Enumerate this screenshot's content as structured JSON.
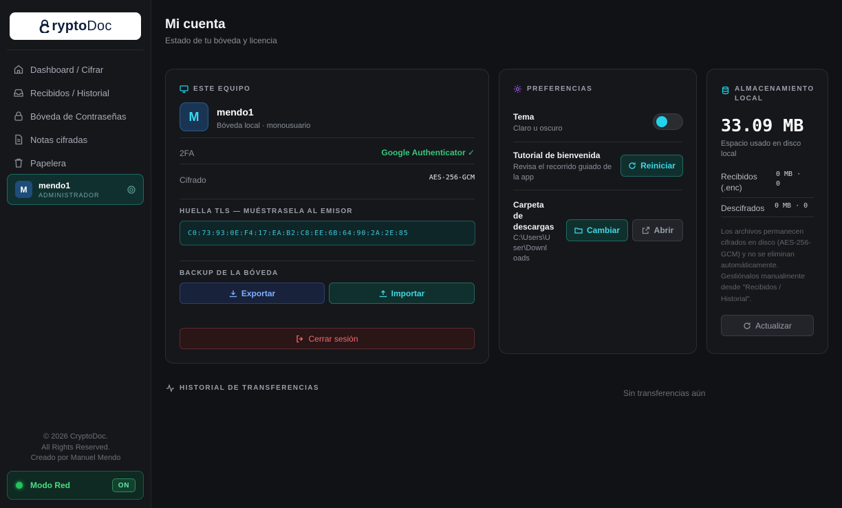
{
  "sidebar": {
    "logo": {
      "mark": "C",
      "rest_bold": "rypto",
      "rest_reg": "Doc"
    },
    "nav": [
      {
        "label": "Dashboard / Cifrar",
        "icon": "home-icon"
      },
      {
        "label": "Recibidos / Historial",
        "icon": "inbox-icon"
      },
      {
        "label": "Bóveda de Contraseñas",
        "icon": "lock-icon"
      },
      {
        "label": "Notas cifradas",
        "icon": "document-icon"
      },
      {
        "label": "Papelera",
        "icon": "trash-icon"
      }
    ],
    "user": {
      "initial": "M",
      "name": "mendo1",
      "role": "ADMINISTRADOR"
    },
    "footer": {
      "line1": "© 2026 CryptoDoc.",
      "line2": "All Rights Reserved.",
      "line3": "Creado por Manuel Mendo"
    },
    "network": {
      "label": "Modo Red",
      "badge": "ON"
    }
  },
  "header": {
    "title": "Mi cuenta",
    "subtitle": "Estado de tu bóveda y licencia"
  },
  "equipo": {
    "heading": "ESTE EQUIPO",
    "initial": "M",
    "name": "mendo1",
    "desc": "Bóveda local · monousuario",
    "twofa_label": "2FA",
    "twofa_value": "Google Authenticator ✓",
    "cipher_label": "Cifrado",
    "cipher_value": "AES-256-GCM",
    "tls_heading": "HUELLA TLS — MUÉSTRASELA AL EMISOR",
    "tls_value": "C0:73:93:0E:F4:17:EA:B2:C8:EE:6B:64:90:2A:2E:85",
    "backup_heading": "BACKUP DE LA BÓVEDA",
    "export_label": "Exportar",
    "import_label": "Importar",
    "logout_label": "Cerrar sesión"
  },
  "preferencias": {
    "heading": "PREFERENCIAS",
    "theme_title": "Tema",
    "theme_sub": "Claro u oscuro",
    "theme_on": true,
    "tutorial_title": "Tutorial de bienvenida",
    "tutorial_sub1": "Revisa el recorrido guiado de",
    "tutorial_sub2": "la app",
    "restart_label": "Reiniciar",
    "folder_title1": "Carpeta",
    "folder_title2": "de",
    "folder_title3": "descargas",
    "folder_path1": "C:\\Users\\U",
    "folder_path2": "ser\\Downl",
    "folder_path3": "oads",
    "change_label": "Cambiar",
    "open_label": "Abrir"
  },
  "almacenamiento": {
    "heading1": "ALMACENAMIENTO",
    "heading2": "LOCAL",
    "used": "33.09 MB",
    "used_label1": "Espacio usado en disco",
    "used_label2": "local",
    "received_label1": "Recibidos",
    "received_label2": "(.enc)",
    "received_value1": "0 MB ·",
    "received_value2": "0",
    "decrypted_label": "Descifrados",
    "decrypted_value": "0 MB · 0",
    "note": [
      "Los archivos permanecen",
      "cifrados en disco (AES-256-",
      "GCM) y no se eliminan",
      "automáticamente.",
      "Gestiónalos manualmente",
      "desde \"Recibidos /",
      "Historial\"."
    ],
    "refresh_label": "Actualizar"
  },
  "historial": {
    "heading": "HISTORIAL DE TRANSFERENCIAS",
    "empty": "Sin transferencias aún"
  },
  "colors": {
    "accent": "#22d3ee",
    "success": "#22c55e",
    "danger": "#f26b6b",
    "bg": "#111215"
  }
}
